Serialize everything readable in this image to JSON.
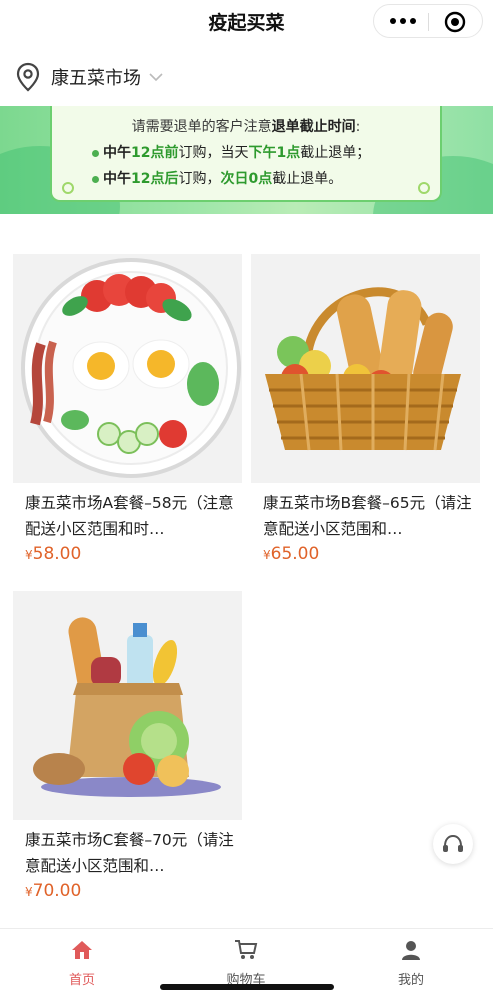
{
  "header": {
    "title": "疫起买菜"
  },
  "location": {
    "name": "康五菜市场"
  },
  "banner": {
    "line1_prefix": "请需要退单的客户注意",
    "line1_emph": "退单截止时间",
    "line1_suffix": ":",
    "rule1": {
      "a": "中午",
      "b": "12点前",
      "c": "订购，当天",
      "d": "下午1点",
      "e": "截止退单；"
    },
    "rule2": {
      "a": "中午",
      "b": "12点后",
      "c": "订购，",
      "d": "次日0点",
      "e": "截止退单。"
    }
  },
  "products": [
    {
      "name": "康五菜市场A套餐–58元（注意配送小区范围和时…",
      "currency": "¥",
      "price": "58.00",
      "image_icon": "breakfast-plate-image"
    },
    {
      "name": "康五菜市场B套餐–65元（请注意配送小区范围和…",
      "currency": "¥",
      "price": "65.00",
      "image_icon": "bread-basket-image"
    },
    {
      "name": "康五菜市场C套餐–70元（请注意配送小区范围和…",
      "currency": "¥",
      "price": "70.00",
      "image_icon": "grocery-bag-image"
    }
  ],
  "tabbar": {
    "home": "首页",
    "cart": "购物车",
    "mine": "我的"
  },
  "colors": {
    "accent": "#e05a5a",
    "price": "#e0632a",
    "banner_green": "#6ccf6f"
  }
}
